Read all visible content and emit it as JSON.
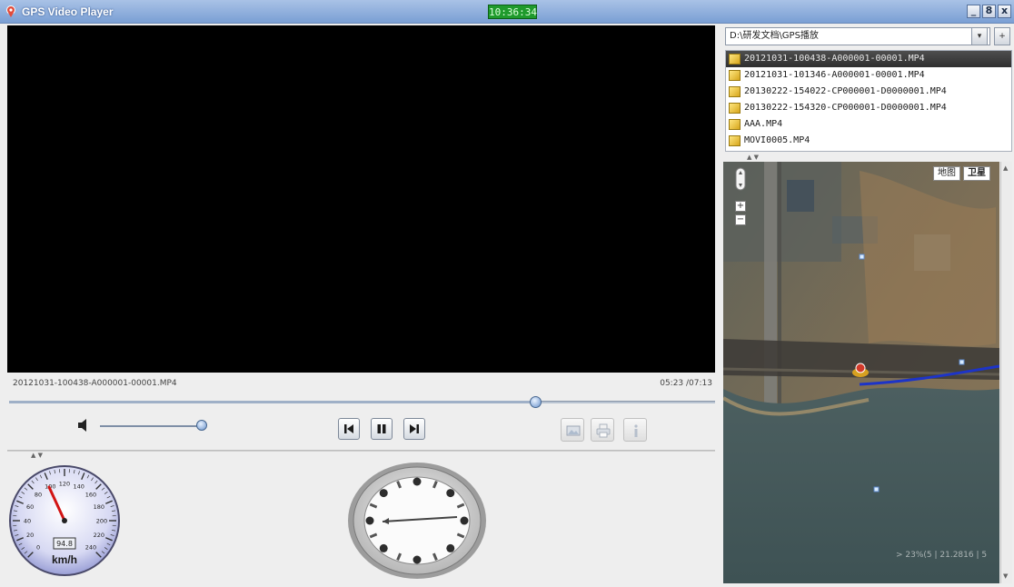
{
  "window": {
    "title": "GPS Video Player",
    "clock": "10:36:34",
    "minimize": "_",
    "maximize": "8",
    "close": "x"
  },
  "player": {
    "filename": "20121031-100438-A000001-00001.MP4",
    "time": "05:23 /07:13",
    "progress": 0.746,
    "volume": 1.0
  },
  "speedometer": {
    "readout": "94.8",
    "unit": "km/h",
    "ticks": [
      "0",
      "20",
      "40",
      "60",
      "80",
      "100",
      "120",
      "140",
      "160",
      "180",
      "200",
      "220",
      "240"
    ]
  },
  "sidebar": {
    "path": "D:\\研发文档\\GPS播放",
    "dropdown_label": "▾",
    "add_label": "+",
    "files": [
      {
        "name": "20121031-100438-A000001-00001.MP4",
        "selected": true
      },
      {
        "name": "20121031-101346-A000001-00001.MP4",
        "selected": false
      },
      {
        "name": "20130222-154022-CP000001-D0000001.MP4",
        "selected": false
      },
      {
        "name": "20130222-154320-CP000001-D0000001.MP4",
        "selected": false
      },
      {
        "name": "AAA.MP4",
        "selected": false
      },
      {
        "name": "MOVI0005.MP4",
        "selected": false
      }
    ]
  },
  "map": {
    "type_map": "地图",
    "type_satellite": "卫星",
    "active_type": "卫星",
    "zoom_in": "+",
    "zoom_out": "−",
    "scale": "> 23%(5  | 21.2816  | 5"
  },
  "colors": {
    "titlebar": "#7a9fd4",
    "clock_bg": "#1f9a2c",
    "route": "#1d34c8",
    "marker": "#d23a2a"
  }
}
